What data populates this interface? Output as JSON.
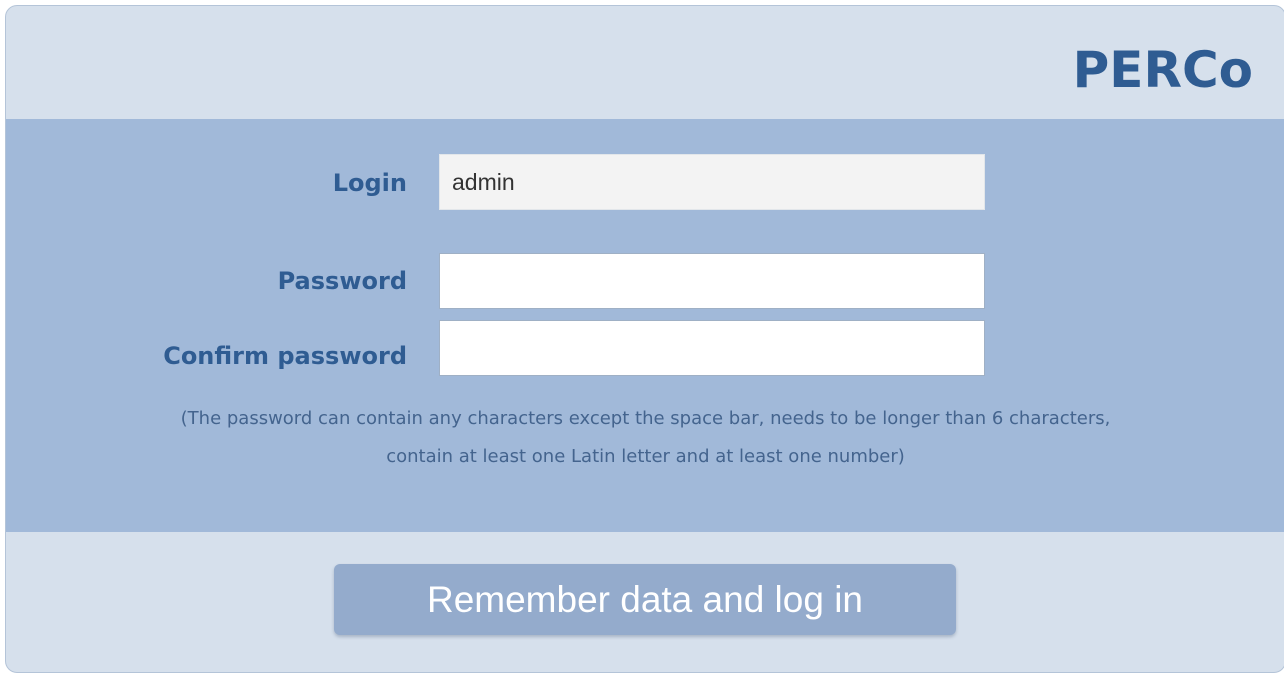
{
  "header": {
    "logo_text": "PERCo"
  },
  "form": {
    "login": {
      "label": "Login",
      "value": "admin"
    },
    "password": {
      "label": "Password",
      "value": ""
    },
    "confirm_password": {
      "label": "Confirm password",
      "value": ""
    },
    "hint_line1": "(The password can contain any characters except the space bar, needs to be longer than 6 characters,",
    "hint_line2": "contain at least one Latin letter and at least one number)"
  },
  "actions": {
    "submit_label": "Remember data and log in"
  },
  "colors": {
    "brand": "#2f5c92",
    "panel_background": "#d6e0ec",
    "form_band": "#a1b9d9",
    "button": "#94abcc"
  }
}
